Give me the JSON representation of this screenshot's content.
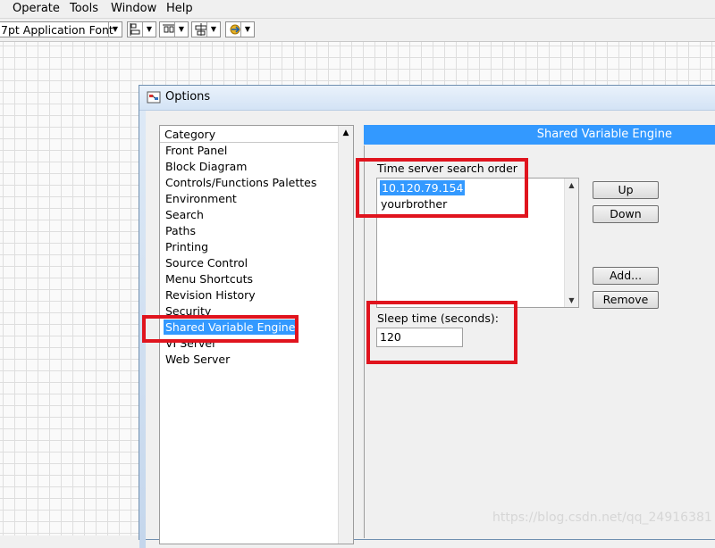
{
  "menubar": {
    "items": [
      "Operate",
      "Tools",
      "Window",
      "Help"
    ]
  },
  "toolbar": {
    "font_selector": "7pt Application Font",
    "icons": [
      "align-objects-icon",
      "distribute-objects-icon",
      "resize-objects-icon",
      "reorder-icon"
    ]
  },
  "dialog": {
    "title": "Options",
    "category": {
      "header": "Category",
      "items": [
        "Front Panel",
        "Block Diagram",
        "Controls/Functions Palettes",
        "Environment",
        "Search",
        "Paths",
        "Printing",
        "Source Control",
        "Menu Shortcuts",
        "Revision History",
        "Security",
        "Shared Variable Engine",
        "VI Server",
        "Web Server"
      ],
      "selected": "Shared Variable Engine"
    },
    "panel": {
      "header": "Shared Variable Engine",
      "time_server_label": "Time server search order",
      "servers": [
        "10.120.79.154",
        "yourbrother"
      ],
      "selected_server": "10.120.79.154",
      "buttons": {
        "up": "Up",
        "down": "Down",
        "add": "Add...",
        "remove": "Remove"
      },
      "sleep_label": "Sleep time (seconds):",
      "sleep_value": "120"
    }
  },
  "watermark": "https://blog.csdn.net/qq_24916381",
  "colors": {
    "selection": "#3399ff",
    "annotation_red": "#e0141e"
  }
}
